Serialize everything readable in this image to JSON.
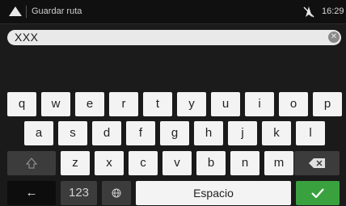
{
  "header": {
    "title": "Guardar ruta",
    "time": "16:29",
    "icons": {
      "nav": "navigation-arrow-icon",
      "gps": "gps-off-icon"
    }
  },
  "search": {
    "value": "XXX",
    "clear_icon": "clear-icon"
  },
  "keyboard": {
    "row1": [
      "q",
      "w",
      "e",
      "r",
      "t",
      "y",
      "u",
      "i",
      "o",
      "p"
    ],
    "row2": [
      "a",
      "s",
      "d",
      "f",
      "g",
      "h",
      "j",
      "k",
      "l"
    ],
    "row3": [
      "z",
      "x",
      "c",
      "v",
      "b",
      "n",
      "m"
    ],
    "shift_icon": "shift-icon",
    "backspace_icon": "backspace-icon",
    "back_icon": "back-arrow-icon",
    "numbers_label": "123",
    "globe_icon": "globe-icon",
    "space_label": "Espacio",
    "confirm_icon": "checkmark-icon"
  },
  "colors": {
    "accent": "#3aa13f",
    "background": "#1a1a1a"
  }
}
